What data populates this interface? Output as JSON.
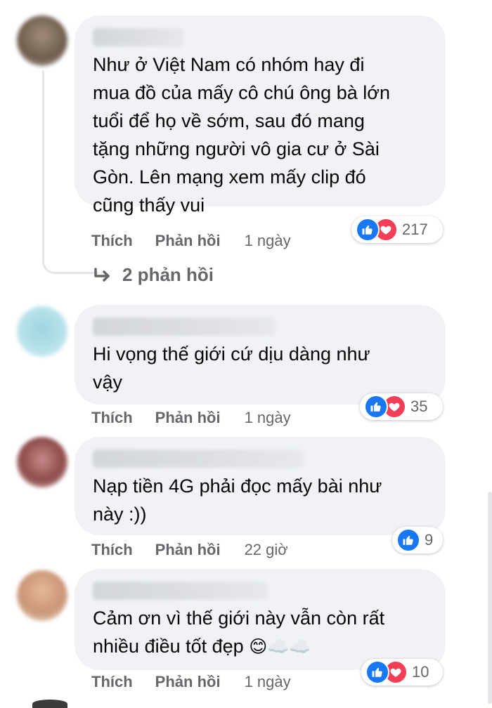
{
  "comments": [
    {
      "text": "Như ở Việt Nam có nhóm hay đi\nmua đồ của mấy cô chú ông bà lớn\ntuổi để họ về sớm, sau đó mang\ntặng những người vô gia cư ở Sài\nGòn. Lên mạng xem mấy clip đó\ncũng thấy vui",
      "like_label": "Thích",
      "reply_label": "Phản hồi",
      "time": "1 ngày",
      "reaction_count": "217",
      "replies_label": "2 phản hồi"
    },
    {
      "text": "Hi vọng thế giới cứ dịu dàng như\nvậy",
      "like_label": "Thích",
      "reply_label": "Phản hồi",
      "time": "1 ngày",
      "reaction_count": "35"
    },
    {
      "text": "Nạp tiền 4G phải đọc mấy bài như\nnày :))",
      "like_label": "Thích",
      "reply_label": "Phản hồi",
      "time": "22 giờ",
      "reaction_count": "9"
    },
    {
      "text": "Cảm ơn vì thế giới này vẫn còn rất\nnhiều điều tốt đẹp",
      "emoji": "😊☁️☁️",
      "like_label": "Thích",
      "reply_label": "Phản hồi",
      "time": "1 ngày",
      "reaction_count": "10"
    }
  ],
  "colors": {
    "like": "#1877f2",
    "love": "#f33e58",
    "bubble": "#f0f2f5",
    "secondary_text": "#65676b"
  },
  "icons": [
    "like-icon",
    "love-icon",
    "reply-arrow-icon"
  ]
}
